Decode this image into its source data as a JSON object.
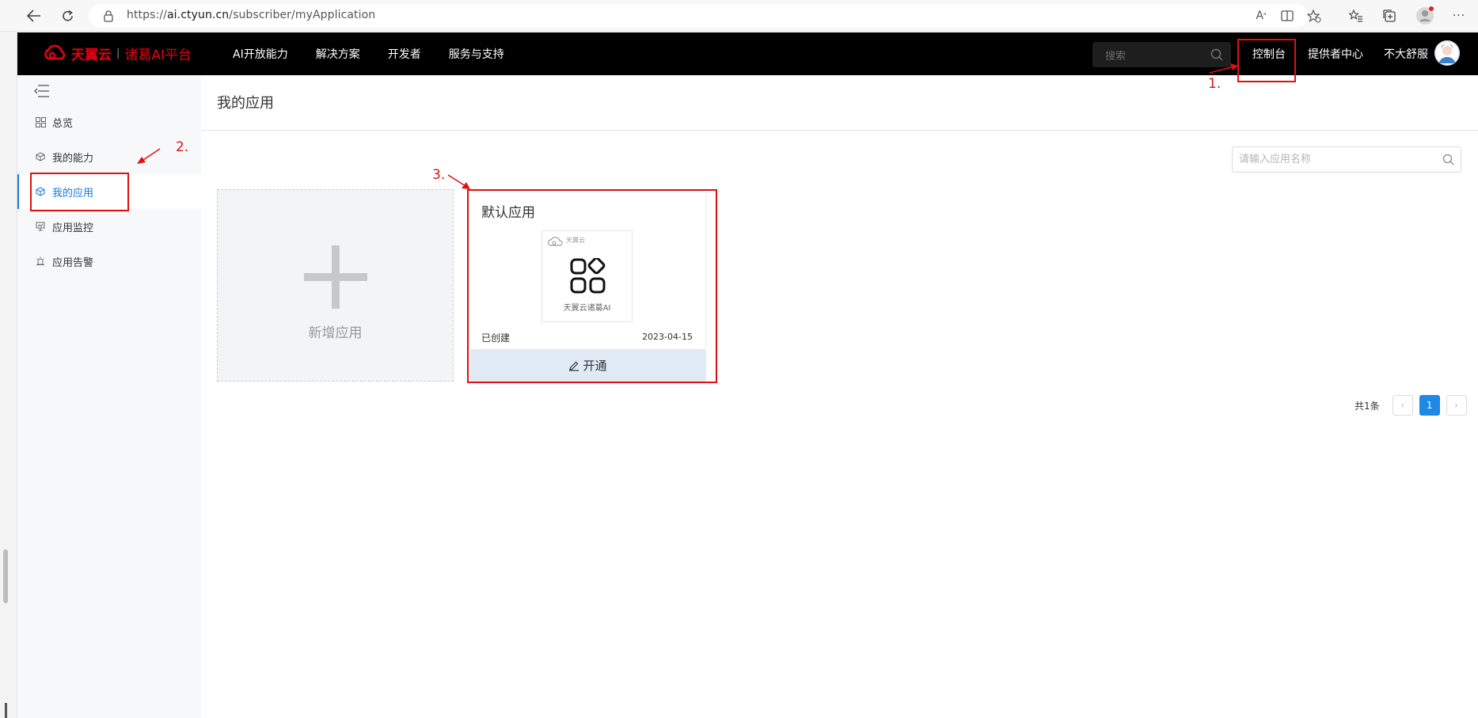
{
  "browser": {
    "url_prefix": "https://",
    "url_host": "ai.ctyun.cn",
    "url_path": "/subscriber/myApplication",
    "back_icon": "back-arrow-icon",
    "reload_icon": "reload-icon",
    "read_aloud_icon": "read-aloud-icon",
    "split_icon": "split-screen-icon",
    "favorite_icon": "favorite-star-icon",
    "favorites_icon": "favorites-list-icon",
    "collections_icon": "collections-icon",
    "profile_icon": "profile-icon",
    "more_label": "···"
  },
  "nav": {
    "brand_left": "天翼云",
    "brand_right": "诸葛AI平台",
    "menu": [
      "AI开放能力",
      "解决方案",
      "开发者",
      "服务与支持"
    ],
    "search_placeholder": "搜索",
    "console": "控制台",
    "provider_center": "提供者中心",
    "username": "不大舒服"
  },
  "sidebar": {
    "items": [
      {
        "label": "总览",
        "icon": "grid-icon"
      },
      {
        "label": "我的能力",
        "icon": "cube-icon"
      },
      {
        "label": "我的应用",
        "icon": "cube-icon",
        "active": true
      },
      {
        "label": "应用监控",
        "icon": "monitor-icon"
      },
      {
        "label": "应用告警",
        "icon": "alarm-icon"
      }
    ]
  },
  "main": {
    "title": "我的应用",
    "search_placeholder": "请输入应用名称",
    "add_card_label": "新增应用",
    "app": {
      "name": "默认应用",
      "logo_caption": "天翼云诸葛AI",
      "logo_brand": "天翼云",
      "status": "已创建",
      "date": "2023-04-15",
      "action": "开通"
    },
    "pagination": {
      "total": "共1条",
      "prev": "‹",
      "current": "1",
      "next": "›"
    }
  },
  "annotations": {
    "step1": "1.",
    "step2": "2.",
    "step3": "3.",
    "color": "#e01010"
  }
}
